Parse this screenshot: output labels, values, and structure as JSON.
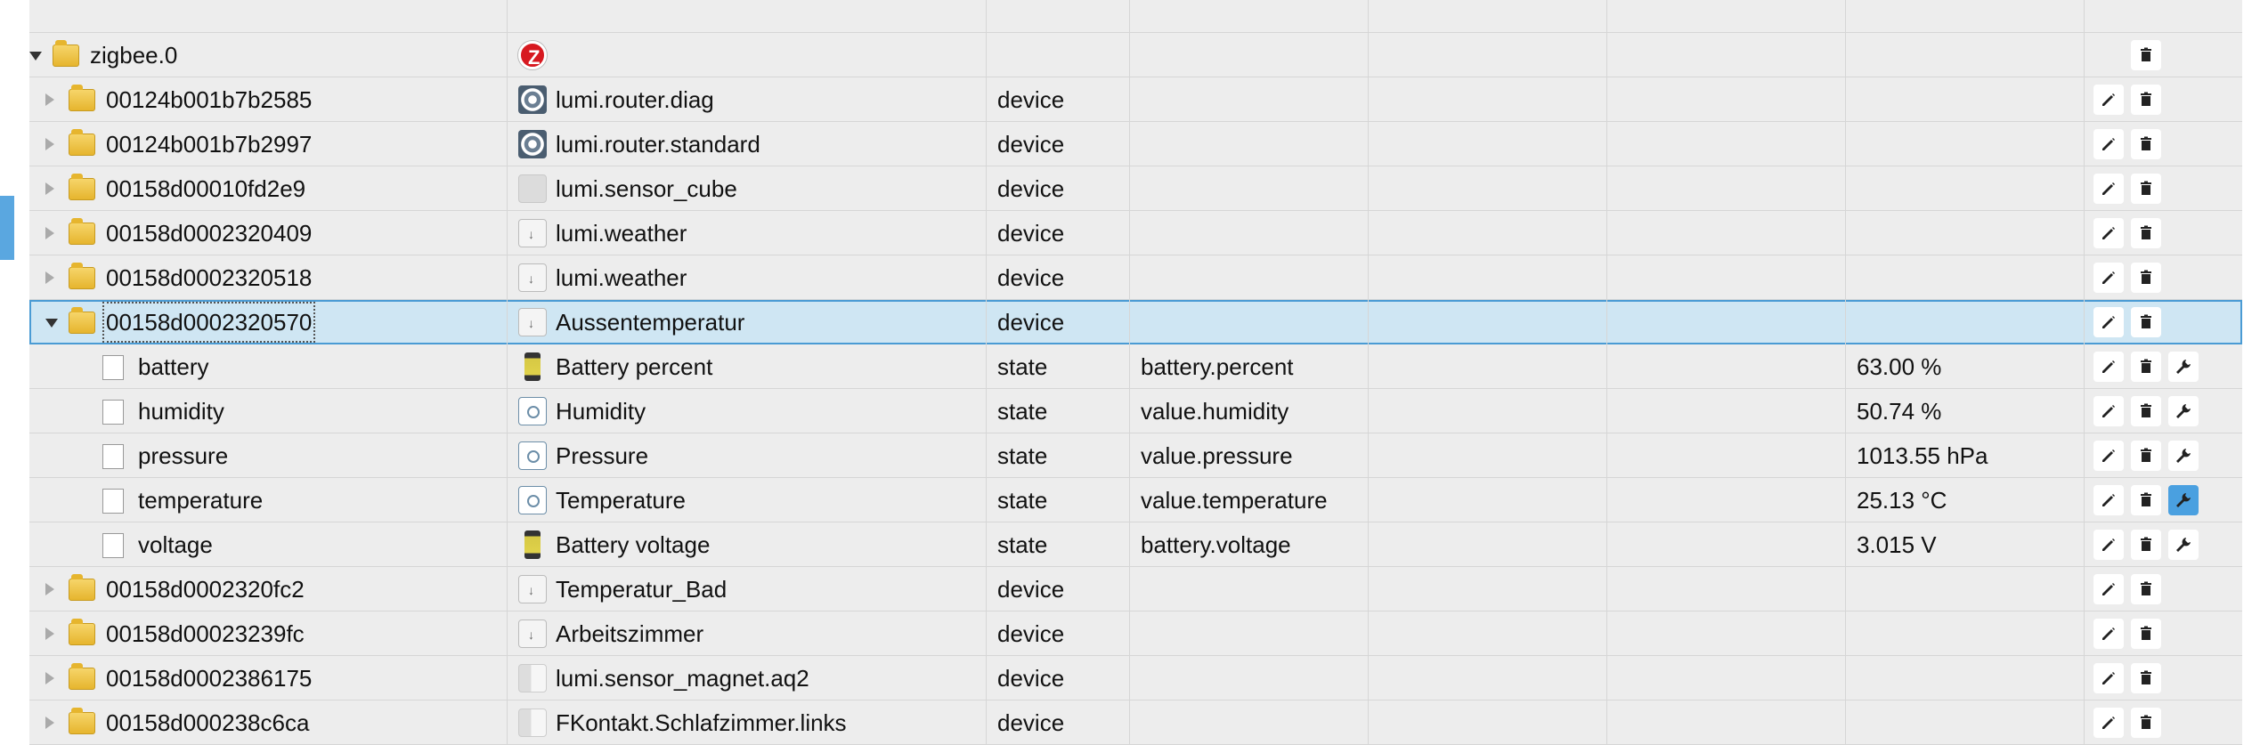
{
  "rows": [
    {
      "kind": "folder",
      "expand": "open",
      "depth": 0,
      "name": "zigbee.0",
      "type_icon": "zigbee-logo",
      "type_name": "",
      "role": "",
      "func": "",
      "value": "",
      "edit": false,
      "del": true,
      "wrench": false
    },
    {
      "kind": "folder",
      "expand": "closed",
      "depth": 1,
      "name": "00124b001b7b2585",
      "type_icon": "router-icon",
      "type_name": "lumi.router.diag",
      "role": "device",
      "func": "",
      "value": "",
      "edit": true,
      "del": true,
      "wrench": false
    },
    {
      "kind": "folder",
      "expand": "closed",
      "depth": 1,
      "name": "00124b001b7b2997",
      "type_icon": "router-icon",
      "type_name": "lumi.router.standard",
      "role": "device",
      "func": "",
      "value": "",
      "edit": true,
      "del": true,
      "wrench": false
    },
    {
      "kind": "folder",
      "expand": "closed",
      "depth": 1,
      "name": "00158d00010fd2e9",
      "type_icon": "cube-icon",
      "type_name": "lumi.sensor_cube",
      "role": "device",
      "func": "",
      "value": "",
      "edit": true,
      "del": true,
      "wrench": false
    },
    {
      "kind": "folder",
      "expand": "closed",
      "depth": 1,
      "name": "00158d0002320409",
      "type_icon": "weather-icon",
      "type_name": "lumi.weather",
      "role": "device",
      "func": "",
      "value": "",
      "edit": true,
      "del": true,
      "wrench": false
    },
    {
      "kind": "folder",
      "expand": "closed",
      "depth": 1,
      "name": "00158d0002320518",
      "type_icon": "weather-icon",
      "type_name": "lumi.weather",
      "role": "device",
      "func": "",
      "value": "",
      "edit": true,
      "del": true,
      "wrench": false
    },
    {
      "kind": "folder",
      "expand": "open",
      "depth": 1,
      "selected": true,
      "name": "00158d0002320570",
      "type_icon": "weather-icon",
      "type_name": "Aussentemperatur",
      "role": "device",
      "func": "",
      "value": "",
      "edit": true,
      "del": true,
      "wrench": false
    },
    {
      "kind": "file",
      "depth": 2,
      "name": "battery",
      "type_icon": "battery-icon",
      "type_name": "Battery percent",
      "role": "state",
      "func": "battery.percent",
      "value": "63.00 %",
      "edit": true,
      "del": true,
      "wrench": true
    },
    {
      "kind": "file",
      "depth": 2,
      "name": "humidity",
      "type_icon": "state-icon",
      "type_name": "Humidity",
      "role": "state",
      "func": "value.humidity",
      "value": "50.74 %",
      "edit": true,
      "del": true,
      "wrench": true
    },
    {
      "kind": "file",
      "depth": 2,
      "name": "pressure",
      "type_icon": "state-icon",
      "type_name": "Pressure",
      "role": "state",
      "func": "value.pressure",
      "value": "1013.55 hPa",
      "edit": true,
      "del": true,
      "wrench": true
    },
    {
      "kind": "file",
      "depth": 2,
      "name": "temperature",
      "type_icon": "state-icon",
      "type_name": "Temperature",
      "role": "state",
      "func": "value.temperature",
      "value": "25.13 °C",
      "edit": true,
      "del": true,
      "wrench": true,
      "wrench_active": true
    },
    {
      "kind": "file",
      "depth": 2,
      "name": "voltage",
      "type_icon": "battery-icon",
      "type_name": "Battery voltage",
      "role": "state",
      "func": "battery.voltage",
      "value": "3.015 V",
      "edit": true,
      "del": true,
      "wrench": true
    },
    {
      "kind": "folder",
      "expand": "closed",
      "depth": 1,
      "name": "00158d0002320fc2",
      "type_icon": "weather-icon",
      "type_name": "Temperatur_Bad",
      "role": "device",
      "func": "",
      "value": "",
      "edit": true,
      "del": true,
      "wrench": false
    },
    {
      "kind": "folder",
      "expand": "closed",
      "depth": 1,
      "name": "00158d00023239fc",
      "type_icon": "weather-icon",
      "type_name": "Arbeitszimmer",
      "role": "device",
      "func": "",
      "value": "",
      "edit": true,
      "del": true,
      "wrench": false
    },
    {
      "kind": "folder",
      "expand": "closed",
      "depth": 1,
      "name": "00158d0002386175",
      "type_icon": "magnet-icon",
      "type_name": "lumi.sensor_magnet.aq2",
      "role": "device",
      "func": "",
      "value": "",
      "edit": true,
      "del": true,
      "wrench": false
    },
    {
      "kind": "folder",
      "expand": "closed",
      "depth": 1,
      "name": "00158d000238c6ca",
      "type_icon": "magnet-icon",
      "type_name": "FKontakt.Schlafzimmer.links",
      "role": "device",
      "func": "",
      "value": "",
      "edit": true,
      "del": true,
      "wrench": false
    }
  ],
  "colors": {
    "row_bg": "#ededed",
    "selected_bg": "#cfe6f3",
    "selected_border": "#4a9bd4",
    "wrench_active": "#4aa0e0"
  }
}
